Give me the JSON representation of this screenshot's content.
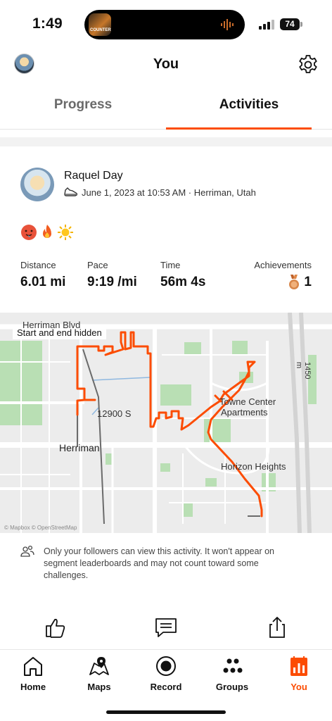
{
  "status_bar": {
    "time": "1:49",
    "battery": "74",
    "now_playing_art_text": "COUNTER"
  },
  "header": {
    "title": "You"
  },
  "tabs": [
    {
      "label": "Progress",
      "active": false
    },
    {
      "label": "Activities",
      "active": true
    }
  ],
  "activity": {
    "athlete": "Raquel Day",
    "meta": "June 1, 2023 at 10:53 AM · Herriman, Utah",
    "emojis": [
      "hot-face",
      "fire",
      "sun"
    ],
    "stats": [
      {
        "label": "Distance",
        "value": "6.01 mi"
      },
      {
        "label": "Pace",
        "value": "9:19 /mi"
      },
      {
        "label": "Time",
        "value": "56m 4s"
      }
    ],
    "achievements": {
      "label": "Achievements",
      "value": "1"
    }
  },
  "map": {
    "chip": "Start and end hidden",
    "labels": {
      "herriman_blvd": "Herriman Blvd",
      "street_12900": "12900 S",
      "herriman": "Herriman",
      "towne_center": "Towne Center",
      "apartments": "Apartments",
      "horizon_heights": "Horizon Heights",
      "highway": "1450 m"
    },
    "credit": "© Mapbox © OpenStreetMap",
    "route_color": "#fc4c02"
  },
  "privacy": {
    "text": "Only your followers can view this activity. It won't appear on segment leaderboards and may not count toward some challenges."
  },
  "actions": [
    "like-icon",
    "comment-icon",
    "share-icon"
  ],
  "nav": [
    {
      "label": "Home",
      "icon": "home-icon",
      "active": false
    },
    {
      "label": "Maps",
      "icon": "maps-icon",
      "active": false
    },
    {
      "label": "Record",
      "icon": "record-icon",
      "active": false
    },
    {
      "label": "Groups",
      "icon": "groups-icon",
      "active": false
    },
    {
      "label": "You",
      "icon": "you-icon",
      "active": true
    }
  ],
  "colors": {
    "accent": "#fc4c02",
    "text": "#111111",
    "muted": "#6a6a6a"
  }
}
